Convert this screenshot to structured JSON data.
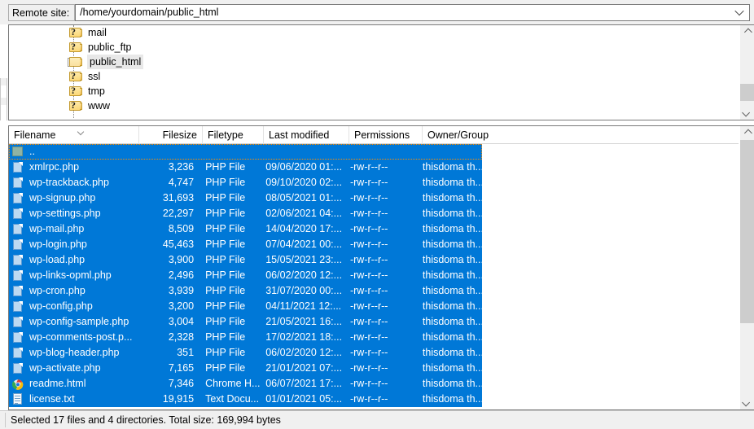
{
  "remote_bar": {
    "label": "Remote site:",
    "path": "/home/yourdomain/public_html",
    "dropdown_icon": "chevron-down-icon"
  },
  "tree": {
    "items": [
      {
        "label": "mail",
        "icon": "folder-unknown-icon",
        "expandable": false,
        "selected": false
      },
      {
        "label": "public_ftp",
        "icon": "folder-unknown-icon",
        "expandable": false,
        "selected": false
      },
      {
        "label": "public_html",
        "icon": "folder-icon",
        "expandable": true,
        "selected": true
      },
      {
        "label": "ssl",
        "icon": "folder-unknown-icon",
        "expandable": false,
        "selected": false
      },
      {
        "label": "tmp",
        "icon": "folder-unknown-icon",
        "expandable": false,
        "selected": false
      },
      {
        "label": "www",
        "icon": "folder-unknown-icon",
        "expandable": false,
        "selected": false
      }
    ],
    "expander_icon": "plus-box-icon"
  },
  "file_list": {
    "columns": [
      {
        "key": "name",
        "label": "Filename"
      },
      {
        "key": "size",
        "label": "Filesize"
      },
      {
        "key": "type",
        "label": "Filetype"
      },
      {
        "key": "modified",
        "label": "Last modified"
      },
      {
        "key": "permissions",
        "label": "Permissions"
      },
      {
        "key": "owner",
        "label": "Owner/Group"
      }
    ],
    "sort_indicator": "chevron-down-icon",
    "rows": [
      {
        "name": "..",
        "size": "",
        "type": "",
        "modified": "",
        "permissions": "",
        "owner": "",
        "icon": "parent-folder-icon",
        "selected": true,
        "focused": true
      },
      {
        "name": "xmlrpc.php",
        "size": "3,236",
        "type": "PHP File",
        "modified": "09/06/2020 01:...",
        "permissions": "-rw-r--r--",
        "owner": "thisdoma th...",
        "icon": "php-file-icon",
        "selected": true,
        "focused": false
      },
      {
        "name": "wp-trackback.php",
        "size": "4,747",
        "type": "PHP File",
        "modified": "09/10/2020 02:...",
        "permissions": "-rw-r--r--",
        "owner": "thisdoma th...",
        "icon": "php-file-icon",
        "selected": true,
        "focused": false
      },
      {
        "name": "wp-signup.php",
        "size": "31,693",
        "type": "PHP File",
        "modified": "08/05/2021 01:...",
        "permissions": "-rw-r--r--",
        "owner": "thisdoma th...",
        "icon": "php-file-icon",
        "selected": true,
        "focused": false
      },
      {
        "name": "wp-settings.php",
        "size": "22,297",
        "type": "PHP File",
        "modified": "02/06/2021 04:...",
        "permissions": "-rw-r--r--",
        "owner": "thisdoma th...",
        "icon": "php-file-icon",
        "selected": true,
        "focused": false
      },
      {
        "name": "wp-mail.php",
        "size": "8,509",
        "type": "PHP File",
        "modified": "14/04/2020 17:...",
        "permissions": "-rw-r--r--",
        "owner": "thisdoma th...",
        "icon": "php-file-icon",
        "selected": true,
        "focused": false
      },
      {
        "name": "wp-login.php",
        "size": "45,463",
        "type": "PHP File",
        "modified": "07/04/2021 00:...",
        "permissions": "-rw-r--r--",
        "owner": "thisdoma th...",
        "icon": "php-file-icon",
        "selected": true,
        "focused": false
      },
      {
        "name": "wp-load.php",
        "size": "3,900",
        "type": "PHP File",
        "modified": "15/05/2021 23:...",
        "permissions": "-rw-r--r--",
        "owner": "thisdoma th...",
        "icon": "php-file-icon",
        "selected": true,
        "focused": false
      },
      {
        "name": "wp-links-opml.php",
        "size": "2,496",
        "type": "PHP File",
        "modified": "06/02/2020 12:...",
        "permissions": "-rw-r--r--",
        "owner": "thisdoma th...",
        "icon": "php-file-icon",
        "selected": true,
        "focused": false
      },
      {
        "name": "wp-cron.php",
        "size": "3,939",
        "type": "PHP File",
        "modified": "31/07/2020 00:...",
        "permissions": "-rw-r--r--",
        "owner": "thisdoma th...",
        "icon": "php-file-icon",
        "selected": true,
        "focused": false
      },
      {
        "name": "wp-config.php",
        "size": "3,200",
        "type": "PHP File",
        "modified": "04/11/2021 12:...",
        "permissions": "-rw-r--r--",
        "owner": "thisdoma th...",
        "icon": "php-file-icon",
        "selected": true,
        "focused": false
      },
      {
        "name": "wp-config-sample.php",
        "size": "3,004",
        "type": "PHP File",
        "modified": "21/05/2021 16:...",
        "permissions": "-rw-r--r--",
        "owner": "thisdoma th...",
        "icon": "php-file-icon",
        "selected": true,
        "focused": false
      },
      {
        "name": "wp-comments-post.p...",
        "size": "2,328",
        "type": "PHP File",
        "modified": "17/02/2021 18:...",
        "permissions": "-rw-r--r--",
        "owner": "thisdoma th...",
        "icon": "php-file-icon",
        "selected": true,
        "focused": false
      },
      {
        "name": "wp-blog-header.php",
        "size": "351",
        "type": "PHP File",
        "modified": "06/02/2020 12:...",
        "permissions": "-rw-r--r--",
        "owner": "thisdoma th...",
        "icon": "php-file-icon",
        "selected": true,
        "focused": false
      },
      {
        "name": "wp-activate.php",
        "size": "7,165",
        "type": "PHP File",
        "modified": "21/01/2021 07:...",
        "permissions": "-rw-r--r--",
        "owner": "thisdoma th...",
        "icon": "php-file-icon",
        "selected": true,
        "focused": false
      },
      {
        "name": "readme.html",
        "size": "7,346",
        "type": "Chrome H...",
        "modified": "06/07/2021 17:...",
        "permissions": "-rw-r--r--",
        "owner": "thisdoma th...",
        "icon": "chrome-html-file-icon",
        "selected": true,
        "focused": false
      },
      {
        "name": "license.txt",
        "size": "19,915",
        "type": "Text Docu...",
        "modified": "01/01/2021 05:...",
        "permissions": "-rw-r--r--",
        "owner": "thisdoma th...",
        "icon": "text-file-icon",
        "selected": true,
        "focused": false
      }
    ]
  },
  "status_bar": {
    "text": "Selected 17 files and 4 directories. Total size: 169,994 bytes"
  },
  "scrollbars": {
    "up_icon": "arrow-up-icon",
    "down_icon": "arrow-down-icon"
  },
  "colors": {
    "selection": "#0078d7",
    "focus_outline": "#ff8c00",
    "panel_border": "#7a7a7a",
    "chrome_window": "#f0f0f0"
  }
}
